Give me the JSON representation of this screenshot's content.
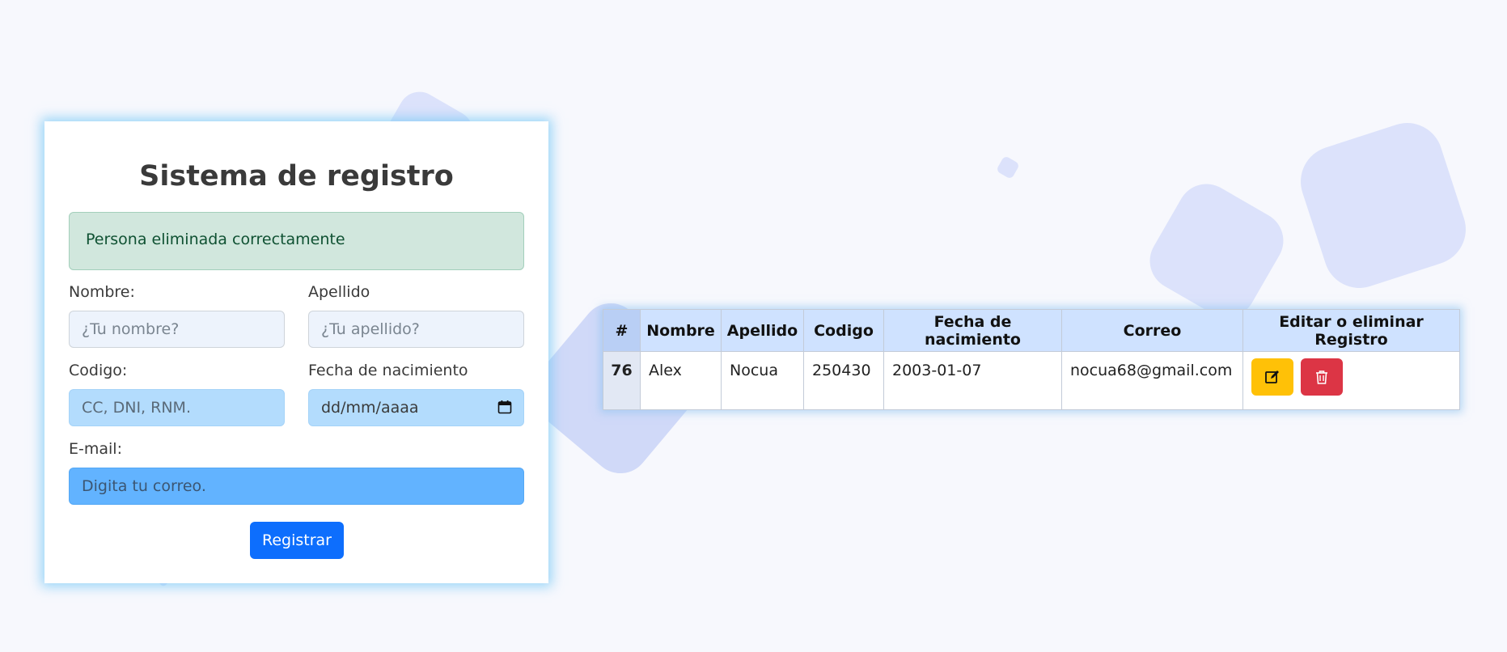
{
  "form": {
    "title": "Sistema de registro",
    "alert": "Persona eliminada correctamente",
    "fields": {
      "nombre": {
        "label": "Nombre:",
        "placeholder": "¿Tu nombre?"
      },
      "apellido": {
        "label": "Apellido",
        "placeholder": "¿Tu apellido?"
      },
      "codigo": {
        "label": "Codigo:",
        "placeholder": "CC, DNI, RNM."
      },
      "fecha": {
        "label": "Fecha de nacimiento",
        "placeholder": "dd/mm/aaaa"
      },
      "email": {
        "label": "E-mail:",
        "placeholder": "Digita tu correo."
      }
    },
    "submit_label": "Registrar"
  },
  "table": {
    "headers": [
      "#",
      "Nombre",
      "Apellido",
      "Codigo",
      "Fecha de nacimiento",
      "Correo",
      "Editar o eliminar Registro"
    ],
    "rows": [
      {
        "id": "76",
        "nombre": "Alex",
        "apellido": "Nocua",
        "codigo": "250430",
        "fecha": "2003-01-07",
        "correo": "nocua68@gmail.com"
      }
    ],
    "icons": {
      "edit": "edit-icon",
      "delete": "trash-icon"
    }
  },
  "colors": {
    "primary": "#0d6efd",
    "success_bg": "#d1e7dd",
    "warning": "#ffc107",
    "danger": "#dc3545",
    "header_bg": "#cfe2ff"
  }
}
